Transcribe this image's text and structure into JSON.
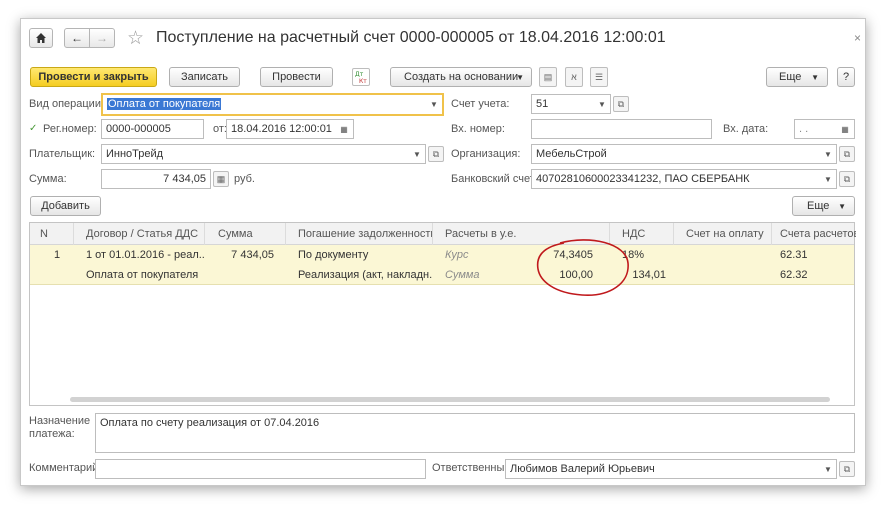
{
  "window": {
    "title": "Поступление на расчетный счет 0000-000005 от 18.04.2016 12:00:01",
    "close_glyph": "×"
  },
  "toolbar": {
    "post_close_label": "Провести и закрыть",
    "save_label": "Записать",
    "post_label": "Провести",
    "create_based_label": "Создать на основании",
    "more_label": "Еще",
    "help_label": "?"
  },
  "form": {
    "operation_label": "Вид операции:",
    "operation_value": "Оплата от покупателя",
    "account_label": "Счет учета:",
    "account_value": "51",
    "regnum_label": "Рег.номер:",
    "regnum_value": "0000-000005",
    "from_label": "от:",
    "date_value": "18.04.2016 12:00:01",
    "incoming_num_label": "Вх. номер:",
    "incoming_num_value": "",
    "incoming_date_label": "Вх. дата:",
    "incoming_date_value": ". .",
    "payer_label": "Плательщик:",
    "payer_value": "ИнноТрейд",
    "org_label": "Организация:",
    "org_value": "МебельСтрой",
    "sum_label": "Сумма:",
    "sum_value": "7 434,05",
    "currency": "руб.",
    "bank_account_label": "Банковский счет:",
    "bank_account_value": "40702810600023341232, ПАО СБЕРБАНК"
  },
  "table_toolbar": {
    "add_label": "Добавить",
    "more_label": "Еще"
  },
  "table": {
    "columns": [
      "N",
      "Договор / Статья ДДС",
      "Сумма",
      "Погашение задолженности",
      "Расчеты в у.е.",
      "НДС",
      "Счет на оплату",
      "Счета расчетов"
    ],
    "rows": [
      {
        "n": "1",
        "contract": "1 от 01.01.2016 - реал...",
        "sum": "7 434,05",
        "debt": "По документу",
        "ue_label": "Курс",
        "ue_value": "74,3405",
        "vat": "18%",
        "invoice": "",
        "account": "62.31"
      },
      {
        "n": "",
        "contract": "Оплата от покупателя",
        "sum": "",
        "debt": "Реализация (акт, накладн...",
        "ue_label": "Сумма",
        "ue_value": "100,00",
        "vat": "134,01",
        "invoice": "",
        "account": "62.32"
      }
    ]
  },
  "footer": {
    "purpose_label": "Назначение платежа:",
    "purpose_value": "Оплата по счету   реализация от 07.04.2016",
    "comment_label": "Комментарий:",
    "comment_value": "",
    "responsible_label": "Ответственный:",
    "responsible_value": "Любимов Валерий Юрьевич"
  },
  "annotation_color": "#c0191c"
}
